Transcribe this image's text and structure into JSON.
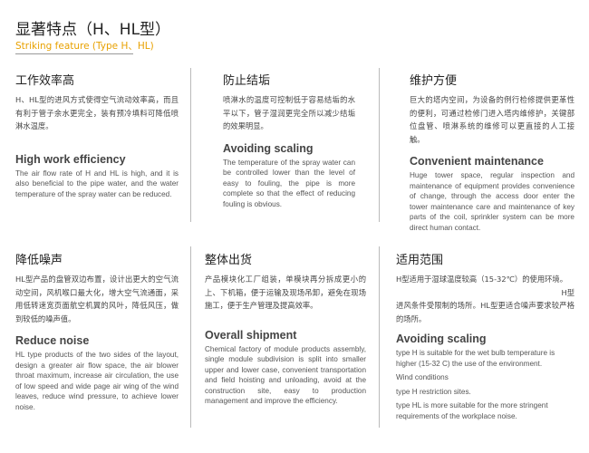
{
  "header": {
    "title_cn": "显著特点（H、HL型）",
    "title_en": "Striking feature (Type H、HL)"
  },
  "sections": {
    "efficiency": {
      "title_cn": "工作效率高",
      "text_cn": "H、HL型的进风方式使得空气流动效率高，而且有利于管子余水更完全，装有预冷填料可降低喷淋水温度。",
      "title_en": "High work efficiency",
      "text_en": "The air flow rate of H and HL is high, and it is also beneficial to the pipe water, and the water temperature of the spray water can be reduced."
    },
    "scaling": {
      "title_cn": "防止结垢",
      "text_cn": "喷淋水的温度可控制低于容易结垢的水平以下，管子湿润更完全所以减少结垢的效果明显。",
      "title_en": "Avoiding scaling",
      "text_en": "The temperature of the spray water can be controlled lower than the level of easy to fouling, the pipe is more complete so that the effect of reducing fouling is obvious."
    },
    "maintenance": {
      "title_cn": "维护方便",
      "text_cn": "巨大的塔内空间，为设备的例行检修提供更革性的便利，可通过检修门进入塔内维修护，关键部位盘管、喷淋系统的维修可以更直接的人工接触。",
      "title_en": "Convenient maintenance",
      "text_en": "Huge tower space, regular inspection and maintenance of equipment provides convenience of change, through the access door enter the tower maintenance care and maintenance of key parts of the coil, sprinkler system can be more direct human contact."
    },
    "noise": {
      "title_cn": "降低噪声",
      "text_cn": "HL型产品的盘管双边布置，设计出更大的空气流动空间，风机喉口最大化，增大空气流通面，采用低转速宽页面航空机翼的风叶，降低风压，做到较低的噪声值。",
      "title_en": "Reduce noise",
      "text_en": "HL type products of the two sides of the layout, design a greater air flow space, the air blower throat maximum, increase air circulation, the use of low speed and wide page air wing of the wind leaves, reduce wind pressure, to achieve lower noise."
    },
    "shipment": {
      "title_cn": "整体出货",
      "text_cn": "产品模块化工厂组装，单模块再分拆成更小的上、下机箱，便于运输及现场吊卸，避免在现场施工，便于生产管理及提高效率。",
      "title_en": "Overall shipment",
      "text_en": "Chemical factory of module products assembly, single module subdivision is split into smaller upper and lower case, convenient transportation and field hoisting and unloading, avoid at the construction site, easy to production management and improve the efficiency."
    },
    "range": {
      "title_cn": "适用范围",
      "text_cn_1": "H型适用于湿球温度较高（15-32℃）的使用环境。",
      "text_cn_2": "H型",
      "text_cn_3": "进风条件受限制的场所。HL型更适合噪声要求较严格的场所。",
      "title_en": "Avoiding scaling",
      "items_en": [
        "type H is suitable for the wet bulb temperature is higher (15-32 C) the use of the environment.",
        "Wind conditions",
        "type H restriction sites.",
        "type HL is more suitable for the more stringent requirements of the workplace noise."
      ]
    }
  }
}
